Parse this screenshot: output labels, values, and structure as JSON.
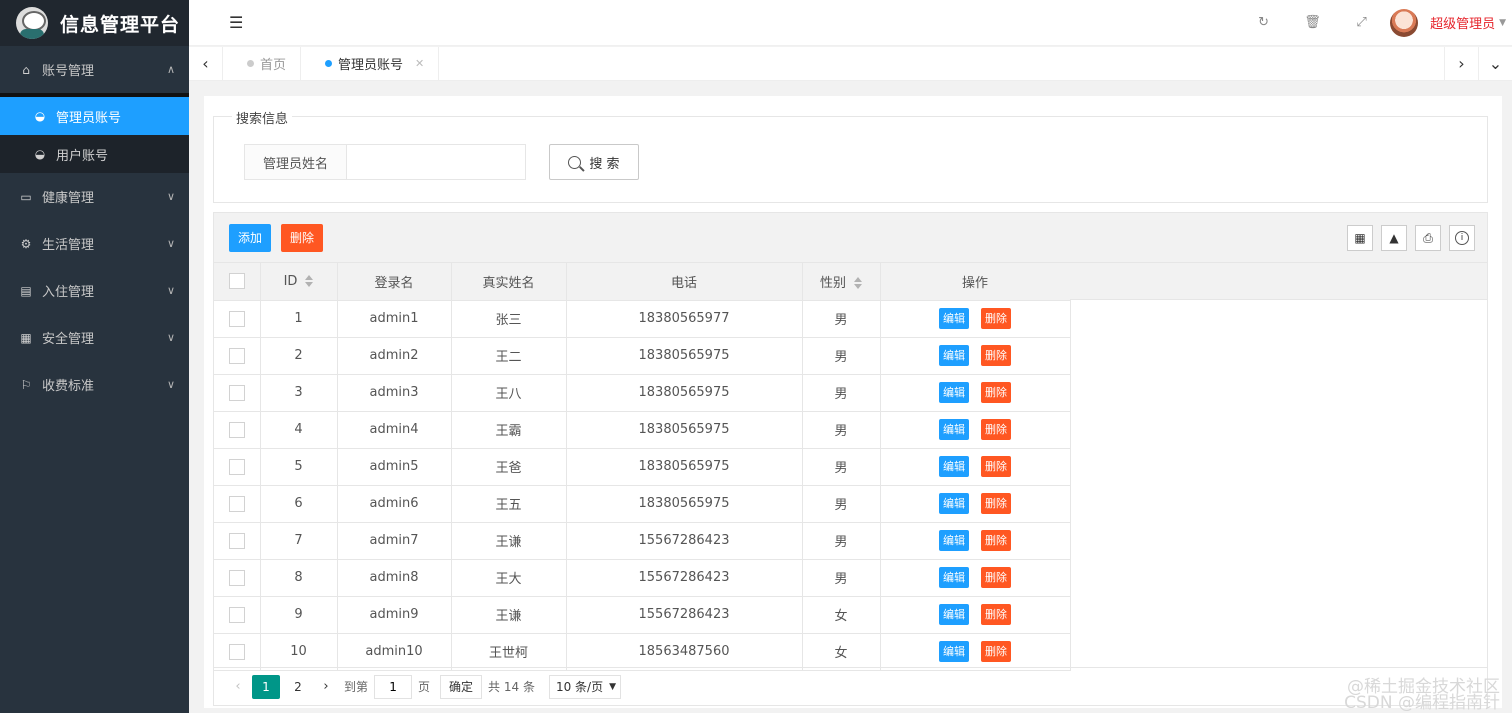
{
  "app": {
    "title": "信息管理平台"
  },
  "sidebar": {
    "groups": [
      {
        "label": "账号管理",
        "icon": "home-icon",
        "expanded": true,
        "items": [
          {
            "label": "管理员账号",
            "icon": "dashboard-icon",
            "active": true
          },
          {
            "label": "用户账号",
            "icon": "dashboard-icon",
            "active": false
          }
        ]
      },
      {
        "label": "健康管理",
        "icon": "window-icon"
      },
      {
        "label": "生活管理",
        "icon": "gears-icon"
      },
      {
        "label": "入住管理",
        "icon": "file-icon"
      },
      {
        "label": "安全管理",
        "icon": "calendar-icon"
      },
      {
        "label": "收费标准",
        "icon": "flag-icon"
      }
    ]
  },
  "header": {
    "user_name": "超级管理员"
  },
  "tabs": [
    {
      "label": "首页",
      "active": false
    },
    {
      "label": "管理员账号",
      "active": true
    }
  ],
  "search": {
    "legend": "搜索信息",
    "field_label": "管理员姓名",
    "field_value": "",
    "button_label": "搜 索"
  },
  "toolbar": {
    "add_label": "添加",
    "delete_label": "删除"
  },
  "table": {
    "columns": [
      "ID",
      "登录名",
      "真实姓名",
      "电话",
      "性别",
      "操作"
    ],
    "edit_label": "编辑",
    "delete_label": "删除",
    "rows": [
      {
        "id": "1",
        "login": "admin1",
        "name": "张三",
        "phone": "18380565977",
        "gender": "男"
      },
      {
        "id": "2",
        "login": "admin2",
        "name": "王二",
        "phone": "18380565975",
        "gender": "男"
      },
      {
        "id": "3",
        "login": "admin3",
        "name": "王八",
        "phone": "18380565975",
        "gender": "男"
      },
      {
        "id": "4",
        "login": "admin4",
        "name": "王霸",
        "phone": "18380565975",
        "gender": "男"
      },
      {
        "id": "5",
        "login": "admin5",
        "name": "王爸",
        "phone": "18380565975",
        "gender": "男"
      },
      {
        "id": "6",
        "login": "admin6",
        "name": "王五",
        "phone": "18380565975",
        "gender": "男"
      },
      {
        "id": "7",
        "login": "admin7",
        "name": "王谦",
        "phone": "15567286423",
        "gender": "男"
      },
      {
        "id": "8",
        "login": "admin8",
        "name": "王大",
        "phone": "15567286423",
        "gender": "男"
      },
      {
        "id": "9",
        "login": "admin9",
        "name": "王谦",
        "phone": "15567286423",
        "gender": "女"
      },
      {
        "id": "10",
        "login": "admin10",
        "name": "王世柯",
        "phone": "18563487560",
        "gender": "女"
      }
    ]
  },
  "pager": {
    "pages": [
      "1",
      "2"
    ],
    "current": "1",
    "goto_prefix": "到第",
    "goto_value": "1",
    "goto_suffix": "页",
    "confirm_label": "确定",
    "total_text": "共 14 条",
    "page_size": "10 条/页"
  },
  "watermark": {
    "line1": "@稀土掘金技术社区",
    "line2": "CSDN @编程指南针"
  }
}
